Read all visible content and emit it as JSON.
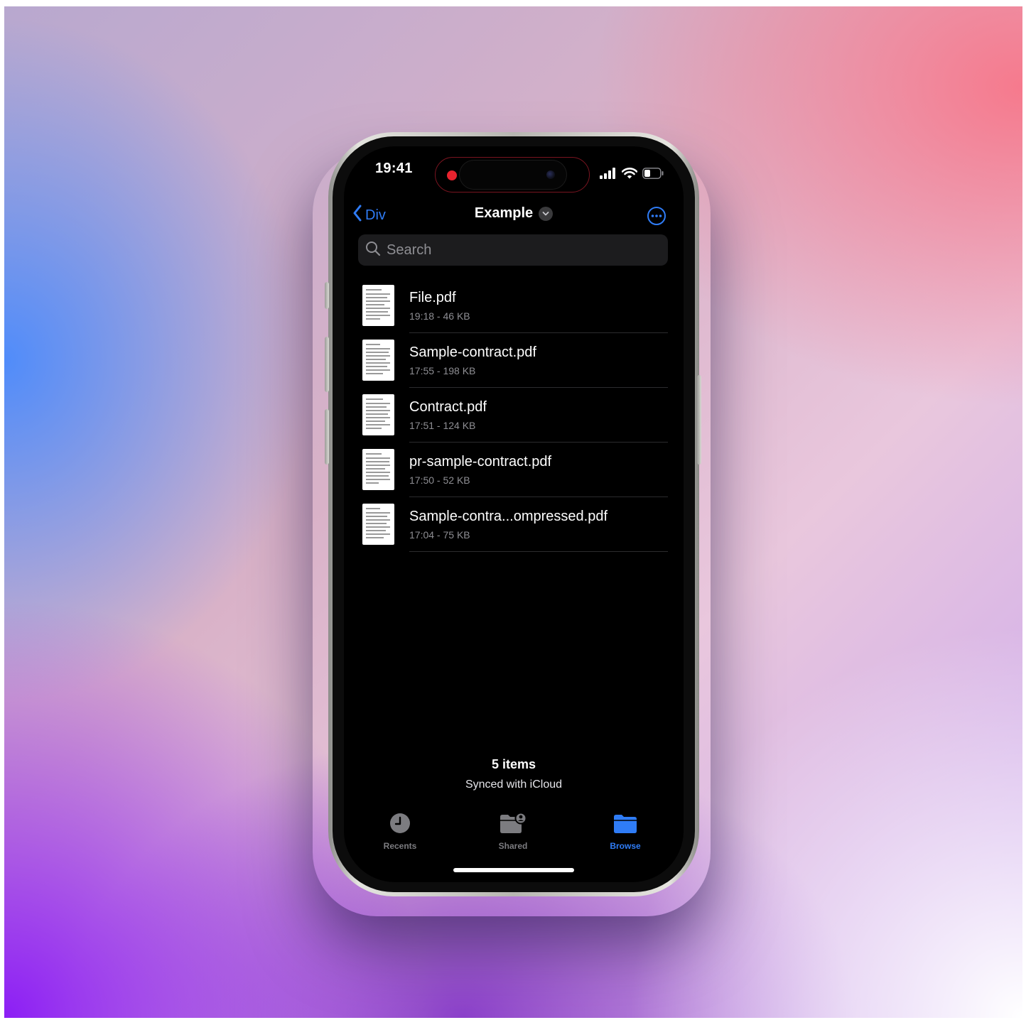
{
  "status_bar": {
    "time": "19:41",
    "icons": [
      "cellular-signal-icon",
      "wifi-icon",
      "battery-icon"
    ]
  },
  "nav": {
    "back_label": "Div",
    "title": "Example",
    "more_icon": "ellipsis-circle-icon"
  },
  "search": {
    "placeholder": "Search"
  },
  "files": [
    {
      "name": "File.pdf",
      "meta": "19:18 - 46 KB"
    },
    {
      "name": "Sample-contract.pdf",
      "meta": "17:55 - 198 KB"
    },
    {
      "name": "Contract.pdf",
      "meta": "17:51 - 124 KB"
    },
    {
      "name": "pr-sample-contract.pdf",
      "meta": "17:50 - 52 KB"
    },
    {
      "name": "Sample-contra...ompressed.pdf",
      "meta": "17:04 - 75 KB"
    }
  ],
  "footer": {
    "count": "5 items",
    "sync": "Synced with iCloud"
  },
  "tabs": [
    {
      "label": "Recents",
      "icon": "clock-icon",
      "active": false
    },
    {
      "label": "Shared",
      "icon": "shared-folder-icon",
      "active": false
    },
    {
      "label": "Browse",
      "icon": "folder-icon",
      "active": true
    }
  ],
  "colors": {
    "accent": "#2f7cf6",
    "screen_bg": "#000000",
    "secondary_text": "#8e8e93",
    "recording_dot": "#e8232e"
  }
}
